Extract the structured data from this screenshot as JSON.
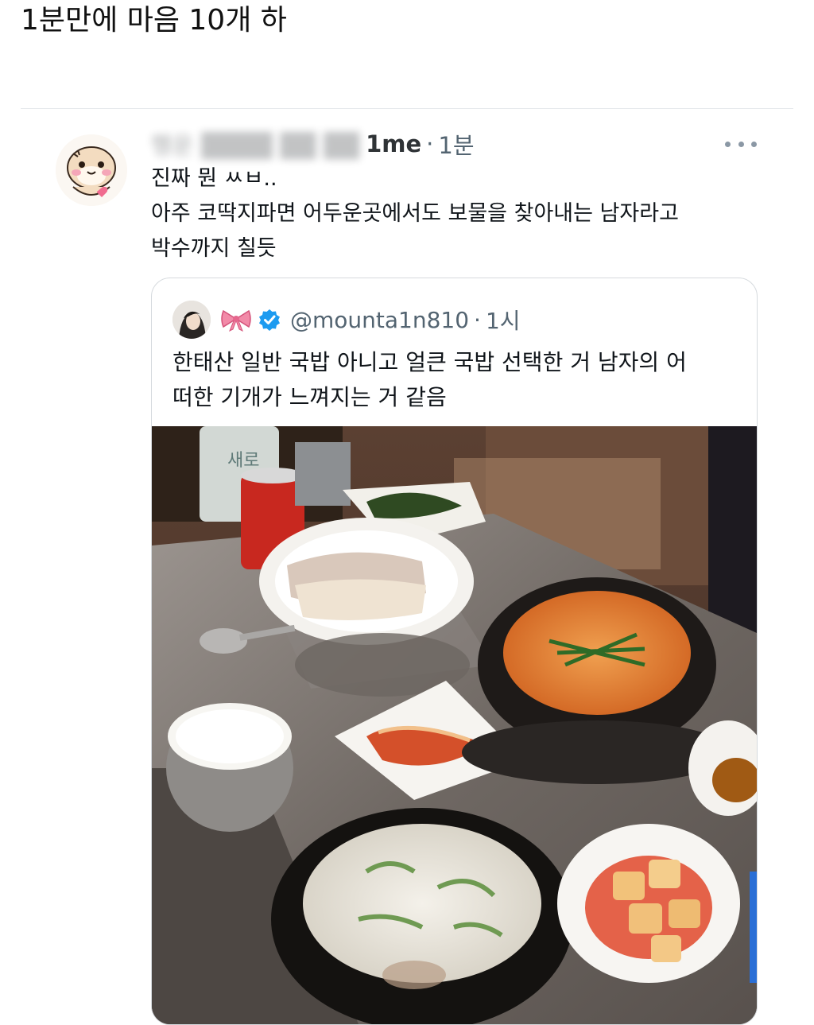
{
  "post": {
    "title": "1분만에 마음 10개 하"
  },
  "tweet": {
    "display_name": "행운 ████ ██ ██",
    "handle_tail": "1me",
    "separator": "·",
    "time": "1분",
    "lines": [
      "진짜 뭔 ㅆㅂ..",
      "아주 코딱지파면 어두운곳에서도 보물을 찾아내는 남자라고",
      "박수까지 칠듯"
    ],
    "avatar_icon": "hamster-avatar-icon",
    "more_icon": "more-options-icon"
  },
  "quote": {
    "handle": "@mounta1n810",
    "separator": "·",
    "time": "1시",
    "lines": [
      "한태산 일반 국밥 아니고 얼큰 국밥 선택한 거 남자의 어",
      "떠한 기개가 느껴지는 거 같음"
    ],
    "name_icon": "pink-bow-icon",
    "verified_icon": "verified-badge-icon",
    "verified_color": "#1d9bf0",
    "photo": {
      "bottle_label": "새로",
      "description_icon": "gukbap-meal-photo"
    }
  }
}
